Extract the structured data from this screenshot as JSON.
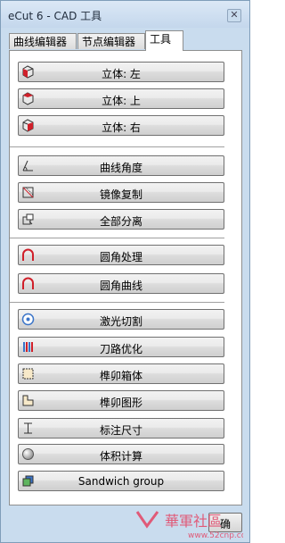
{
  "window": {
    "title": "eCut 6 - CAD 工具",
    "close_glyph": "✕"
  },
  "tabs": [
    {
      "label": "曲线编辑器",
      "active": false
    },
    {
      "label": "节点编辑器",
      "active": false
    },
    {
      "label": "工具",
      "active": true
    }
  ],
  "buttons": {
    "view_left": "立体: 左",
    "view_top": "立体: 上",
    "view_right": "立体: 右",
    "curve_angle": "曲线角度",
    "mirror_copy": "镜像复制",
    "separate_all": "全部分离",
    "fillet": "圆角处理",
    "fillet_curve": "圆角曲线",
    "laser_cut": "激光切割",
    "toolpath_opt": "刀路优化",
    "tenon_box": "榫卯箱体",
    "tenon_shape": "榫卯图形",
    "dimension": "标注尺寸",
    "volume_calc": "体积计算",
    "sandwich": "Sandwich group"
  },
  "footer": {
    "ok_label": "确"
  },
  "watermark": {
    "text": "華軍社區",
    "url": "www.52cnp.com"
  },
  "colors": {
    "accent_red": "#d0202a",
    "accent_blue": "#3a74c8",
    "window_bg": "#c9dcee"
  }
}
